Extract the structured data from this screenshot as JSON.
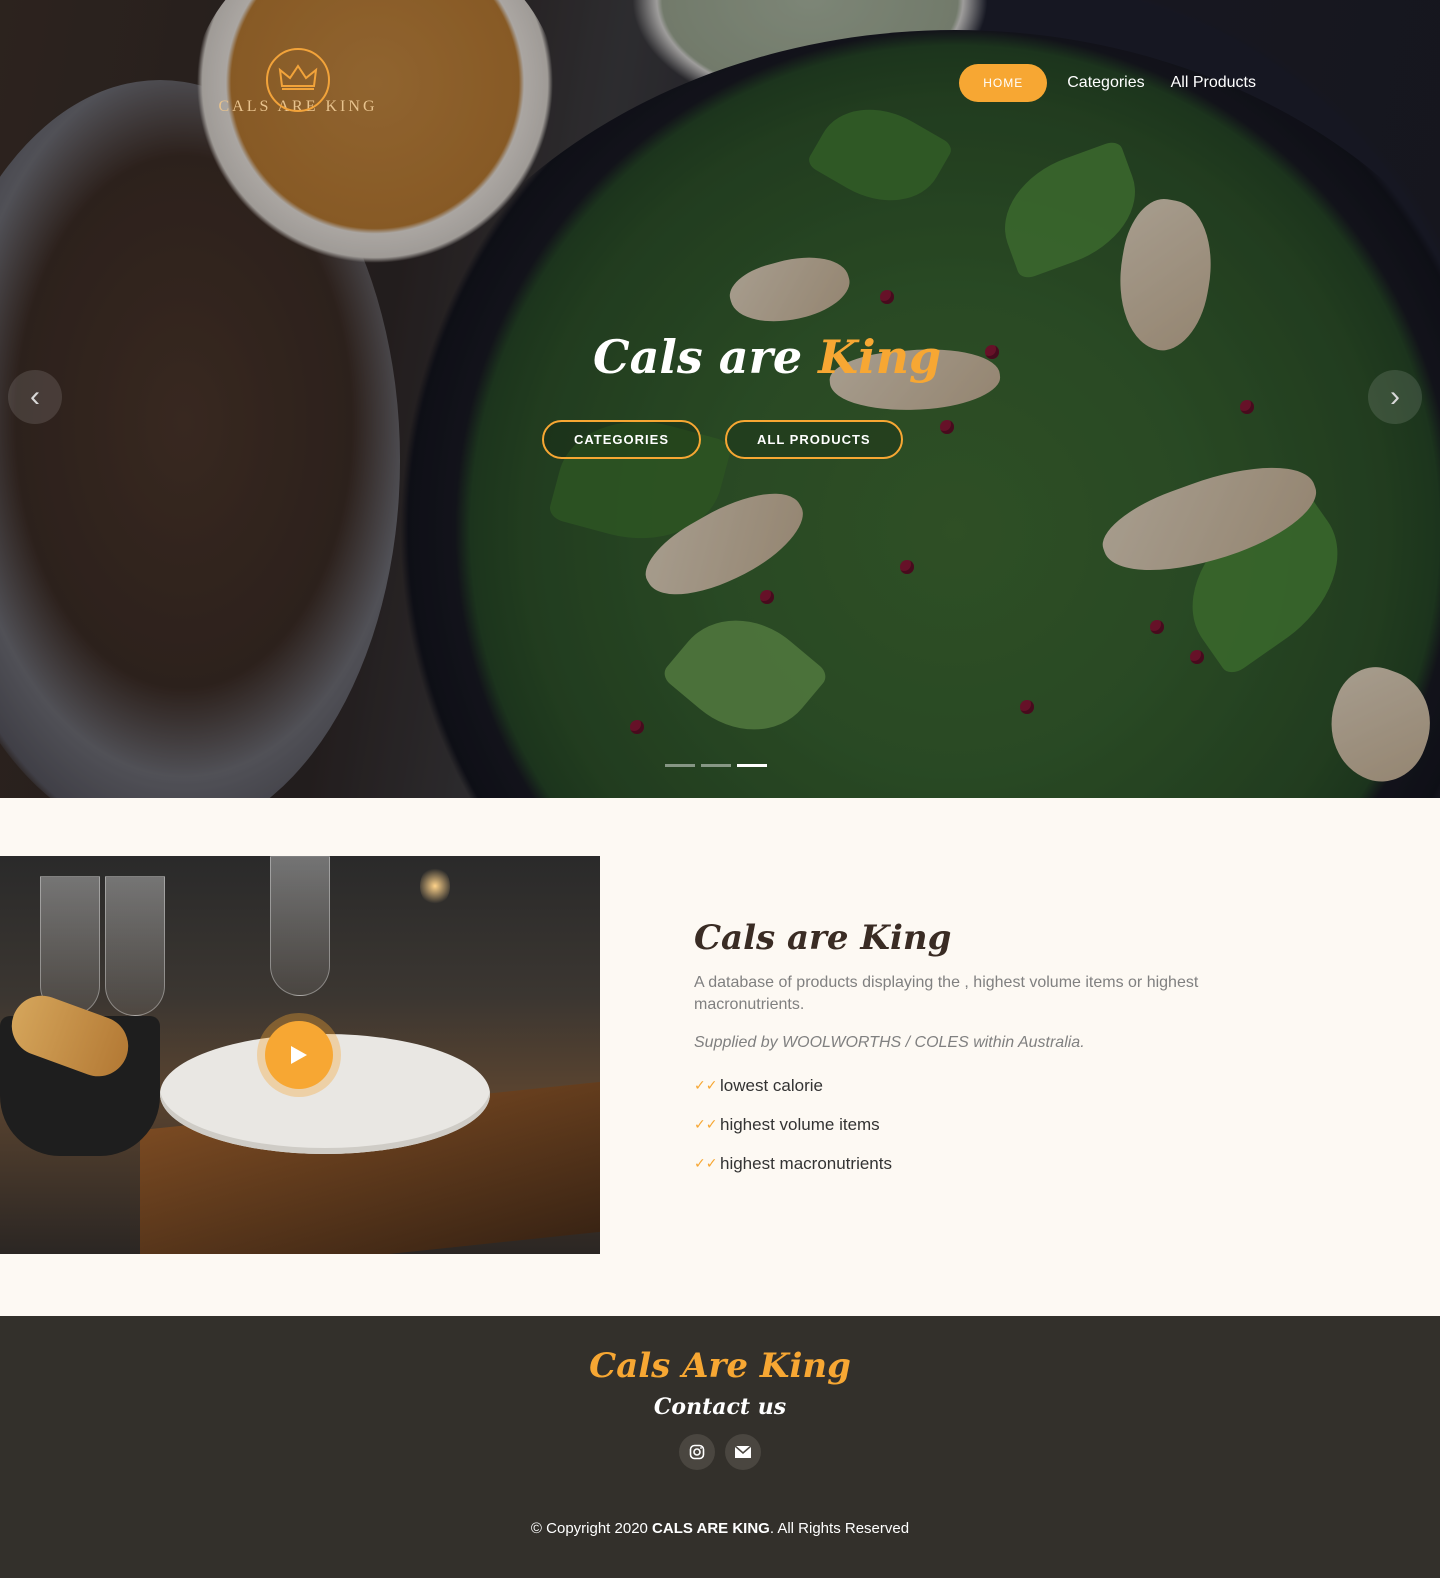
{
  "brand": {
    "logo_text": "CALS ARE KING",
    "accent_color": "#f7a733"
  },
  "nav": {
    "home": "HOME",
    "categories": "Categories",
    "all_products": "All Products"
  },
  "hero": {
    "title_main": "Cals are ",
    "title_accent": "King",
    "btn_categories": "CATEGORIES",
    "btn_all_products": "ALL PRODUCTS",
    "prev_icon": "chevron-left-icon",
    "next_icon": "chevron-right-icon",
    "slides": 3,
    "active_slide": 3
  },
  "about": {
    "title_light": "Cals are ",
    "title_bold": "King",
    "description": "A database of products displaying the , highest volume items or highest macronutrients.",
    "supplied": "Supplied by WOOLWORTHS / COLES within Australia.",
    "features": [
      "lowest calorie",
      "highest volume items",
      "highest macronutrients"
    ],
    "play_icon": "play-icon"
  },
  "footer": {
    "brand": "Cals Are King",
    "contact": "Contact us",
    "social": [
      "instagram-icon",
      "email-icon"
    ],
    "copyright_prefix": "© Copyright 2020 ",
    "copyright_brand": "CALS ARE KING",
    "copyright_suffix": ". All Rights Reserved",
    "background_color": "#33302b"
  }
}
